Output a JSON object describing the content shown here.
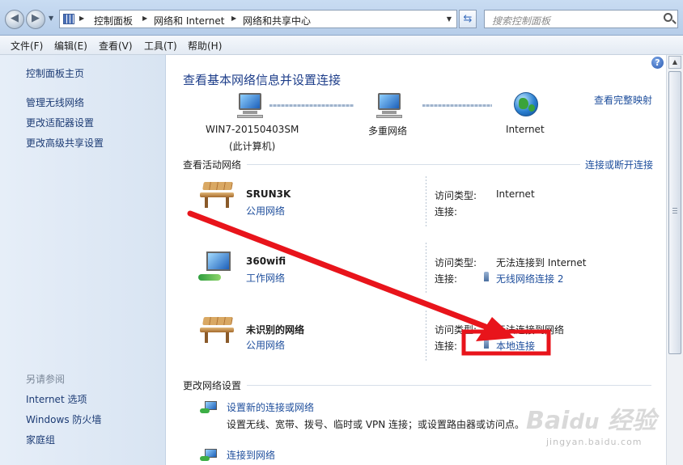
{
  "address_bar": {
    "crumbs": [
      "控制面板",
      "网络和 Internet",
      "网络和共享中心"
    ],
    "search_placeholder": "搜索控制面板"
  },
  "menu": [
    "文件(F)",
    "编辑(E)",
    "查看(V)",
    "工具(T)",
    "帮助(H)"
  ],
  "left_pane": {
    "home": "控制面板主页",
    "links": [
      "管理无线网络",
      "更改适配器设置",
      "更改高级共享设置"
    ],
    "see_also_title": "另请参阅",
    "see_also": [
      "Internet 选项",
      "Windows 防火墙",
      "家庭组"
    ]
  },
  "main": {
    "title": "查看基本网络信息并设置连接",
    "full_map_link": "查看完整映射",
    "map_nodes": [
      {
        "label": "WIN7-20150403SM",
        "sublabel": "(此计算机)"
      },
      {
        "label": "多重网络"
      },
      {
        "label": "Internet"
      }
    ],
    "active_title": "查看活动网络",
    "connect_link": "连接或断开连接",
    "access_type_label": "访问类型:",
    "connection_label": "连接:",
    "networks": [
      {
        "name": "SRUN3K",
        "category": "公用网络",
        "access": "Internet",
        "connection": ""
      },
      {
        "name": "360wifi",
        "category": "工作网络",
        "access": "无法连接到 Internet",
        "connection": "无线网络连接 2"
      },
      {
        "name": "未识别的网络",
        "category": "公用网络",
        "access": "无法连接到网络",
        "connection": "本地连接"
      }
    ],
    "change_title": "更改网络设置",
    "tasks": [
      {
        "link": "设置新的连接或网络",
        "desc": "设置无线、宽带、拨号、临时或 VPN 连接；或设置路由器或访问点。"
      },
      {
        "link": "连接到网络",
        "desc": ""
      }
    ]
  },
  "annotation": {
    "arrow_color": "#e8141b",
    "box_color": "#e8141b"
  },
  "watermark": {
    "text": "jingyan.baidu.com"
  }
}
